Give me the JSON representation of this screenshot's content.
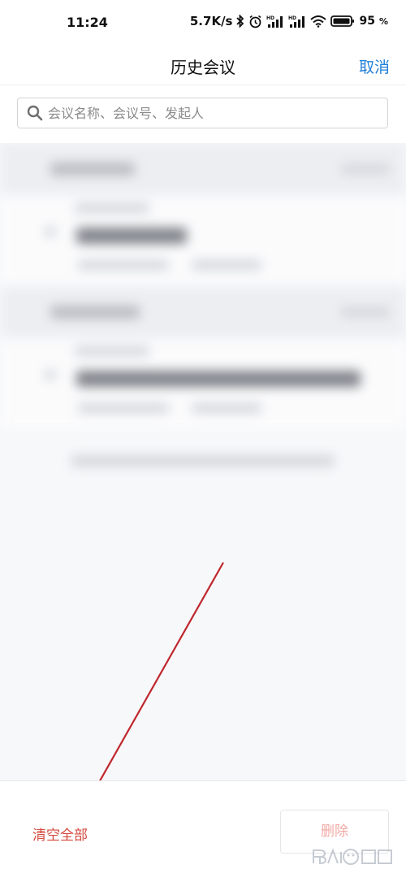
{
  "status_bar": {
    "time": "11:24",
    "net_speed": "5.7K/s",
    "battery_pct": "95",
    "icons": [
      "bluetooth-icon",
      "alarm-icon",
      "signal-hd-icon",
      "signal-hd-icon",
      "wifi-icon",
      "battery-icon"
    ]
  },
  "header": {
    "title": "历史会议",
    "cancel_label": "取消"
  },
  "search": {
    "placeholder": "会议名称、会议号、发起人"
  },
  "bottom_bar": {
    "clear_all_label": "清空全部",
    "delete_label": "删除"
  },
  "colors": {
    "accent": "#1f7fd8",
    "danger": "#d44a3e",
    "danger_disabled": "#f1a9a3",
    "annotation_arrow": "#c0272d"
  }
}
